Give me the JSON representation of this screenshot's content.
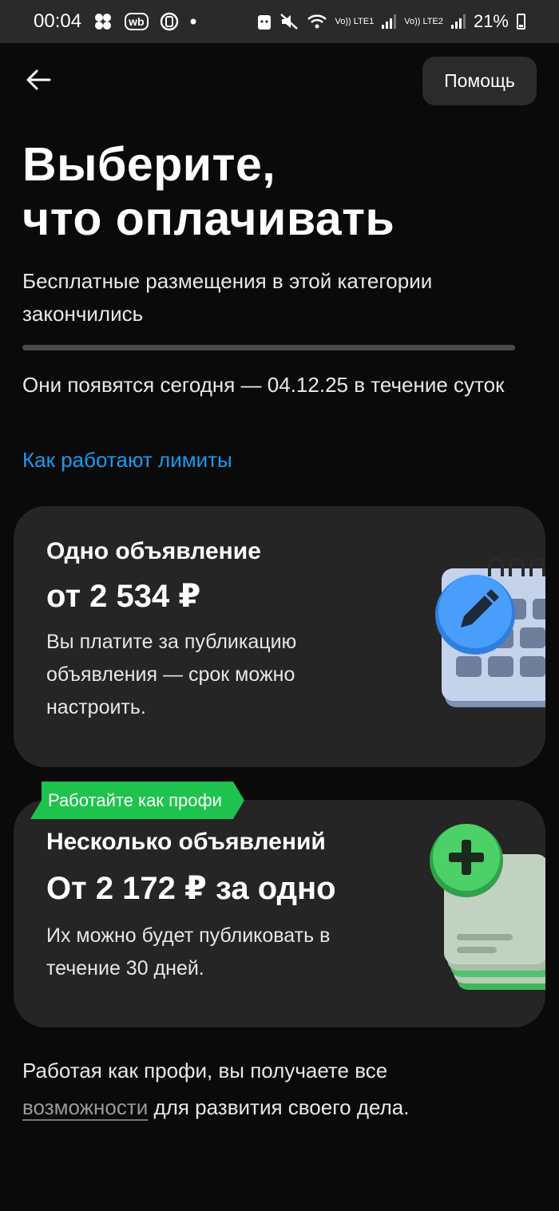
{
  "status_bar": {
    "time": "00:04",
    "wb_label": "wb",
    "lte1": "Vo)) LTE1",
    "lte2": "Vo)) LTE2",
    "battery": "21%",
    "icons": [
      "community-icon",
      "wb-icon",
      "sync-icon",
      "dot-icon",
      "android-icon",
      "mute-vibrate-icon",
      "wifi-icon",
      "signal-icon",
      "battery-icon"
    ]
  },
  "header": {
    "help_label": "Помощь",
    "back_icon": "arrow-left-icon"
  },
  "page": {
    "title_line1": "Выберите,",
    "title_line2": "что оплачивать",
    "subtitle": "Бесплатные размещения в этой категории закончились",
    "info": "Они появятся сегодня — 04.12.25 в течение суток",
    "limits_link": "Как работают лимиты"
  },
  "cards": [
    {
      "title": "Одно объявление",
      "price": "от 2 534 ₽",
      "description": "Вы платите за публикацию объявления — срок можно настроить.",
      "icon": "calendar-edit-icon"
    },
    {
      "badge": "Работайте как профи",
      "title": "Несколько объявлений",
      "price": "От 2 172 ₽ за одно",
      "description": "Их можно будет публиковать в течение 30 дней.",
      "icon": "stack-add-icon"
    }
  ],
  "footer": {
    "text_before": "Работая как профи, вы получаете все",
    "link": "возможности",
    "text_after": " для развития своего дела."
  },
  "colors": {
    "background": "#0a0a0a",
    "card": "#252525",
    "link": "#1a9bef",
    "badge": "#1ec34d"
  }
}
